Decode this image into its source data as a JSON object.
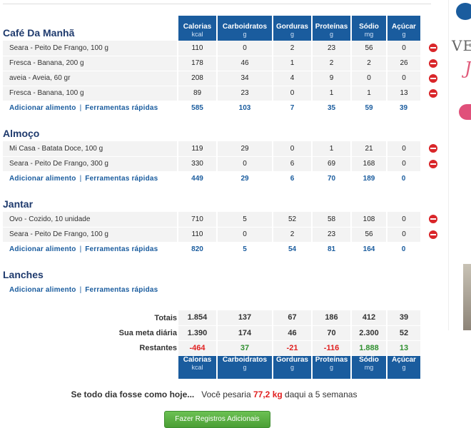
{
  "columns": [
    {
      "label": "Calorias",
      "unit": "kcal"
    },
    {
      "label": "Carboidratos",
      "unit": "g"
    },
    {
      "label": "Gorduras",
      "unit": "g"
    },
    {
      "label": "Proteínas",
      "unit": "g"
    },
    {
      "label": "Sódio",
      "unit": "mg"
    },
    {
      "label": "Açúcar",
      "unit": "g"
    }
  ],
  "links": {
    "add_food": "Adicionar alimento",
    "quick_tools": "Ferramentas rápidas",
    "separator": "|"
  },
  "meals": [
    {
      "title": "Café Da Manhã",
      "foods": [
        {
          "name": "Seara - Peito De Frango, 100 g",
          "values": [
            "110",
            "0",
            "2",
            "23",
            "56",
            "0"
          ]
        },
        {
          "name": "Fresca - Banana, 200 g",
          "values": [
            "178",
            "46",
            "1",
            "2",
            "2",
            "26"
          ]
        },
        {
          "name": "aveia - Aveia, 60 gr",
          "values": [
            "208",
            "34",
            "4",
            "9",
            "0",
            "0"
          ]
        },
        {
          "name": "Fresca - Banana, 100 g",
          "values": [
            "89",
            "23",
            "0",
            "1",
            "1",
            "13"
          ]
        }
      ],
      "totals": [
        "585",
        "103",
        "7",
        "35",
        "59",
        "39"
      ]
    },
    {
      "title": "Almoço",
      "foods": [
        {
          "name": "Mi Casa - Batata Doce, 100 g",
          "values": [
            "119",
            "29",
            "0",
            "1",
            "21",
            "0"
          ]
        },
        {
          "name": "Seara - Peito De Frango, 300 g",
          "values": [
            "330",
            "0",
            "6",
            "69",
            "168",
            "0"
          ]
        }
      ],
      "totals": [
        "449",
        "29",
        "6",
        "70",
        "189",
        "0"
      ]
    },
    {
      "title": "Jantar",
      "foods": [
        {
          "name": "Ovo - Cozido, 10 unidade",
          "values": [
            "710",
            "5",
            "52",
            "58",
            "108",
            "0"
          ]
        },
        {
          "name": "Seara - Peito De Frango, 100 g",
          "values": [
            "110",
            "0",
            "2",
            "23",
            "56",
            "0"
          ]
        }
      ],
      "totals": [
        "820",
        "5",
        "54",
        "81",
        "164",
        "0"
      ]
    },
    {
      "title": "Lanches",
      "foods": [],
      "totals": null
    }
  ],
  "summary": {
    "totals_label": "Totais",
    "totals": [
      "1.854",
      "137",
      "67",
      "186",
      "412",
      "39"
    ],
    "goal_label": "Sua meta diária",
    "goal": [
      "1.390",
      "174",
      "46",
      "70",
      "2.300",
      "52"
    ],
    "remaining_label": "Restantes",
    "remaining": [
      "-464",
      "37",
      "-21",
      "-116",
      "1.888",
      "13"
    ]
  },
  "projection": {
    "lead": "Se todo dia fosse como hoje...",
    "text_before": "Você pesaria",
    "weight": "77,2 kg",
    "text_after": "daqui a 5 semanas"
  },
  "button_label": "Fazer Registros Adicionais",
  "ad": {
    "text_ve": "VE",
    "script_char": "J"
  },
  "colors": {
    "header_blue": "#1a5c9e",
    "title_navy": "#1e3a6d",
    "negative": "#e02020",
    "positive": "#2f8f2f",
    "delete": "#d9262a",
    "button_green": "#4a9e35"
  }
}
